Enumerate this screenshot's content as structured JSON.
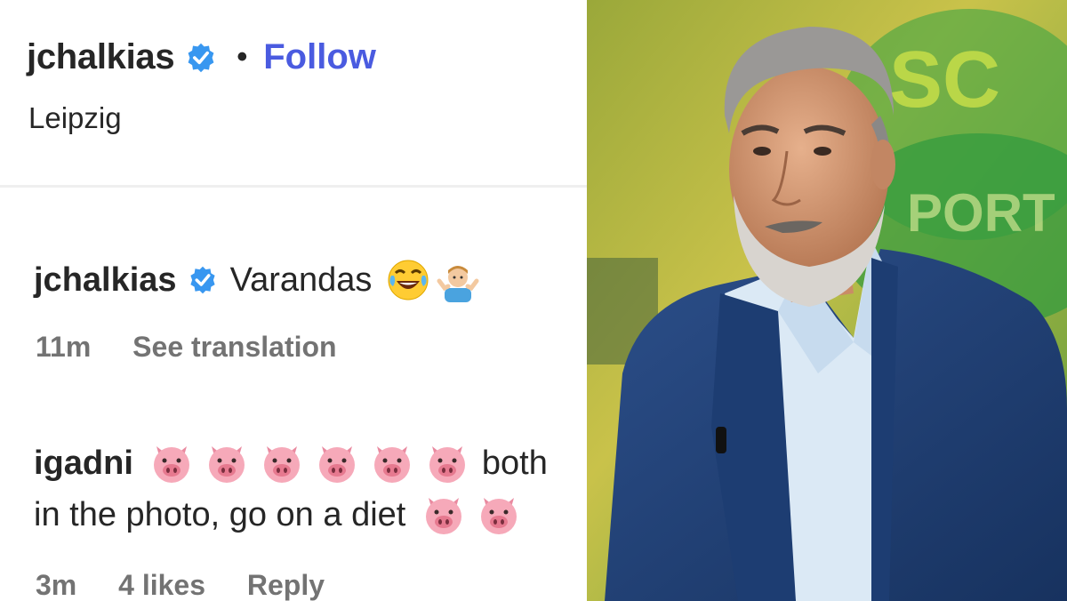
{
  "post": {
    "username": "jchalkias",
    "separator": "•",
    "follow_label": "Follow",
    "location": "Leipzig"
  },
  "comments": [
    {
      "username": "jchalkias",
      "text": "Varandas",
      "emojis": [
        "face-with-tears-of-joy",
        "person-shrugging"
      ],
      "time": "11m",
      "action": "See translation"
    },
    {
      "username": "igadni",
      "text_line1": "both",
      "text_line2": "in the photo, go on a diet",
      "emojis": [
        "pig-face",
        "pig-face",
        "pig-face",
        "pig-face",
        "pig-face",
        "pig-face",
        "pig-face",
        "pig-face"
      ],
      "time": "3m",
      "likes": "4 likes",
      "reply_label": "Reply"
    }
  ],
  "photo": {
    "description_icon": "tv-studio-photo"
  },
  "colors": {
    "follow": "#4a5be0",
    "verified": "#3897f0",
    "meta": "#737373"
  }
}
